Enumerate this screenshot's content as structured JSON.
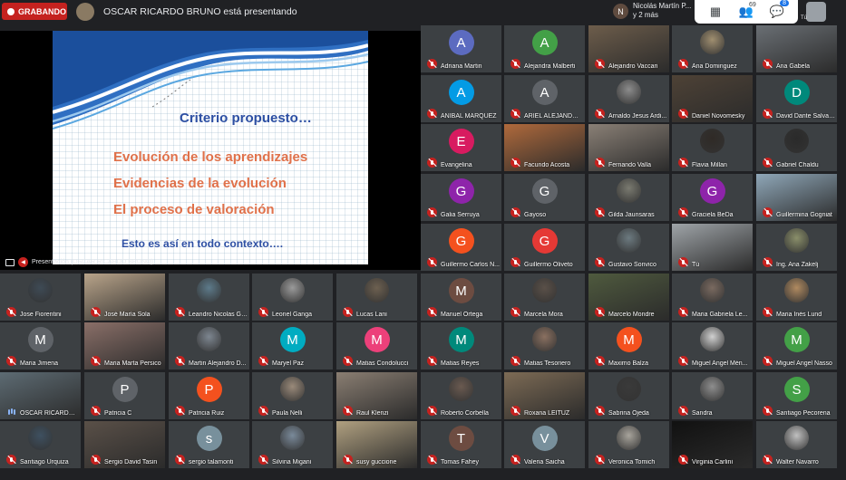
{
  "recording": {
    "label": "GRABANDO"
  },
  "presenter_banner": {
    "text": "OSCAR RICARDO BRUNO está presentando"
  },
  "raised_hands": {
    "avatar_letter": "N",
    "text": "Nicolás Martín P... y 2 más"
  },
  "controls": {
    "participant_count": "69",
    "chat_badge": "8"
  },
  "self_label": "Tú",
  "presentation": {
    "label": "Presentación (OSCAR RICARDO BRUNO)",
    "slide": {
      "title": "Criterio propuesto…",
      "lines": [
        "Evolución de los aprendizajes",
        "Evidencias de la evolución",
        "El proceso de valoración"
      ],
      "footer": "Esto es así en todo contexto…."
    }
  },
  "colors": {
    "accent_recording": "#c5221f",
    "tile_bg": "#3c4043",
    "page_bg": "#202124",
    "active_outline": "#7ee6d5"
  },
  "participants": [
    {
      "name": "Adriana Martin",
      "avatar": "A",
      "color": "#5c6bc0"
    },
    {
      "name": "Alejandra Malberti",
      "avatar": "A",
      "color": "#43a047"
    },
    {
      "name": "Alejandro Vaccari",
      "photo": "#6d5d4b"
    },
    {
      "name": "Ana Dominguez",
      "photo": "#a08f70",
      "small": true
    },
    {
      "name": "Ana Gabela",
      "photo": "#6a6f74"
    },
    {
      "name": "ANIBAL MARQUEZ",
      "avatar": "A",
      "color": "#039be5"
    },
    {
      "name": "ARIEL ALEJANDRO...",
      "avatar": "A",
      "color": "#5f6368"
    },
    {
      "name": "Arnaldo Jesus Ardi...",
      "photo": "#8c8c8c",
      "small": true
    },
    {
      "name": "Daniel Novomesky",
      "photo": "#4e4236"
    },
    {
      "name": "David Dante Salvat...",
      "avatar": "D",
      "color": "#00897b"
    },
    {
      "name": "Evangelina",
      "avatar": "E",
      "color": "#d81b60"
    },
    {
      "name": "Facundo Acosta",
      "photo": "#b06a3c"
    },
    {
      "name": "Fernando Valla",
      "photo": "#8a8076"
    },
    {
      "name": "Flavia Millan",
      "photo": "#2f2a26",
      "small": true
    },
    {
      "name": "Gabriel Chaldu",
      "photo": "#2a2a2a",
      "small": true
    },
    {
      "name": "Galia Serruya",
      "avatar": "G",
      "color": "#8e24aa"
    },
    {
      "name": "Gayoso",
      "avatar": "G",
      "color": "#5f6368"
    },
    {
      "name": "Gilda Jaunsaras",
      "photo": "#7a7a70",
      "small": true
    },
    {
      "name": "Graciela BeDa",
      "avatar": "G",
      "color": "#8e24aa"
    },
    {
      "name": "Guillermina Gogniat",
      "photo": "#8fa7b8"
    },
    {
      "name": "Guillermo Carlos N...",
      "avatar": "G",
      "color": "#f4511e"
    },
    {
      "name": "Guillermo Oliveto",
      "avatar": "G",
      "color": "#e53935"
    },
    {
      "name": "Gustavo Sonvico",
      "photo": "#6c7a80",
      "small": true
    },
    {
      "name": "Tú",
      "photo": "#9fa4a8"
    },
    {
      "name": "Ing. Ana Zakelj",
      "photo": "#8a8f6a",
      "small": true
    },
    {
      "name": "Jose Fiorentini",
      "photo": "#3e4a55",
      "small": true
    },
    {
      "name": "José María Sola",
      "photo": "#b9a48a"
    },
    {
      "name": "Leandro Nicolas Gi...",
      "photo": "#5d7a8a",
      "small": true
    },
    {
      "name": "Leonel Ganga",
      "photo": "#9a9a9a",
      "small": true
    },
    {
      "name": "Lucas Lani",
      "photo": "#6d6050",
      "small": true
    },
    {
      "name": "Manuel Ortega",
      "avatar": "M",
      "color": "#6d4c41"
    },
    {
      "name": "Marcela Mora",
      "photo": "#5a5048",
      "small": true
    },
    {
      "name": "Marcelo Mondre",
      "photo": "#4f5a3e"
    },
    {
      "name": "Maria Gabriela Le...",
      "photo": "#7a6a60",
      "small": true
    },
    {
      "name": "Maria Inés Lund",
      "photo": "#b08a60",
      "small": true
    },
    {
      "name": "Maria Jimena",
      "avatar": "M",
      "color": "#5f6368"
    },
    {
      "name": "Maria Marta Persico",
      "photo": "#8a6f68"
    },
    {
      "name": "Martin Alejandro D...",
      "photo": "#7d8690",
      "small": true
    },
    {
      "name": "Maryel Paz",
      "avatar": "M",
      "color": "#00acc1"
    },
    {
      "name": "Matias Condolucci",
      "avatar": "M",
      "color": "#ec407a"
    },
    {
      "name": "Matias Reyes",
      "avatar": "M",
      "color": "#00897b"
    },
    {
      "name": "Matias Tesoriero",
      "photo": "#8a7060",
      "small": true
    },
    {
      "name": "Maximo Balza",
      "avatar": "M",
      "color": "#f4511e"
    },
    {
      "name": "Miguel Angel Mén...",
      "photo": "#d0d0d0",
      "small": true
    },
    {
      "name": "Miguel Angel Nasso",
      "avatar": "M",
      "color": "#43a047"
    },
    {
      "name": "OSCAR RICARDO ...",
      "photo": "#5d6b73",
      "active": true
    },
    {
      "name": "Patricia C",
      "avatar": "P",
      "color": "#5f6368"
    },
    {
      "name": "Patricia Ruiz",
      "avatar": "P",
      "color": "#f4511e"
    },
    {
      "name": "Paula Nelli",
      "photo": "#9a8a7a",
      "small": true
    },
    {
      "name": "Raul Klenzi",
      "photo": "#8a7e72"
    },
    {
      "name": "Roberto Corbella",
      "photo": "#6a5a50",
      "small": true
    },
    {
      "name": "Roxana LEITUZ",
      "photo": "#7d6b55"
    },
    {
      "name": "Sabrina Ojeda",
      "photo": "#3a3a3a",
      "small": true
    },
    {
      "name": "Sandra",
      "photo": "#8e8e8e",
      "small": true
    },
    {
      "name": "Santiago Pecorena",
      "avatar": "S",
      "color": "#43a047"
    },
    {
      "name": "Santiago Urquiza",
      "photo": "#3e5060",
      "small": true
    },
    {
      "name": "Sergio David Tasin",
      "photo": "#5a5048"
    },
    {
      "name": "sergio talamonti",
      "avatar": "s",
      "color": "#78909c"
    },
    {
      "name": "Silvina Migani",
      "photo": "#7a8a9a",
      "small": true
    },
    {
      "name": "susy guccione",
      "photo": "#b0a080"
    },
    {
      "name": "Tomas Fahey",
      "avatar": "T",
      "color": "#6d4c41"
    },
    {
      "name": "Valeria Saicha",
      "avatar": "V",
      "color": "#78909c"
    },
    {
      "name": "Veronica Tomich",
      "photo": "#a8a49c",
      "small": true
    },
    {
      "name": "Virginia Carlini",
      "photo": "#111111"
    },
    {
      "name": "Walter Navarro",
      "photo": "#c0c0c0",
      "small": true
    }
  ]
}
